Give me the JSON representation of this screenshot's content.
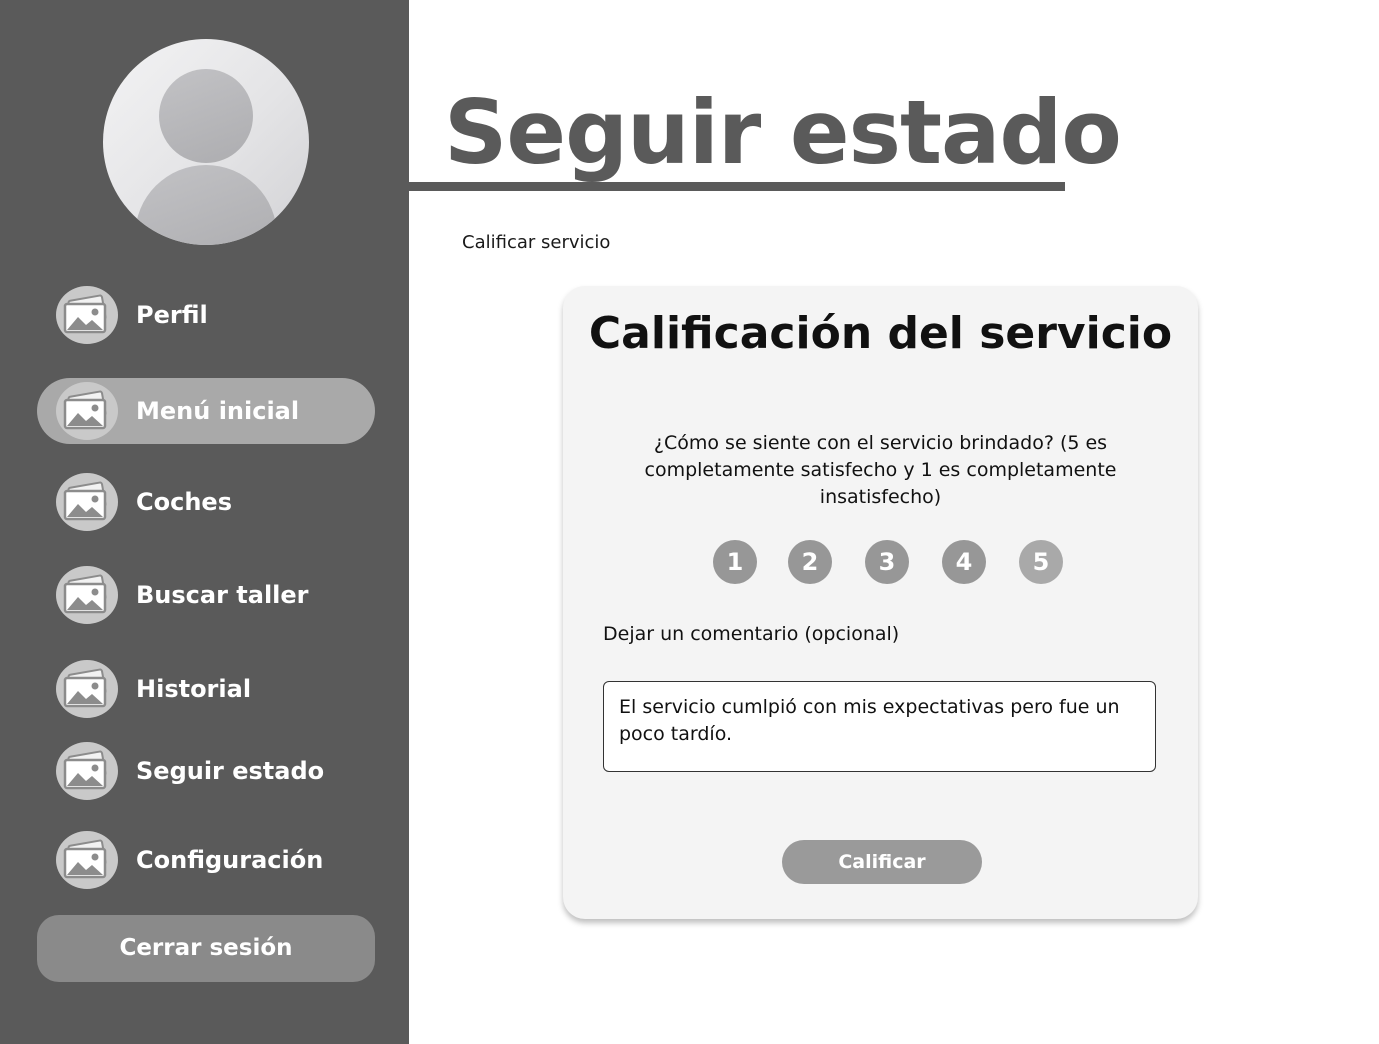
{
  "sidebar": {
    "items": [
      {
        "label": "Perfil",
        "icon": "image-icon",
        "active": false
      },
      {
        "label": "Menú inicial",
        "icon": "image-icon",
        "active": true
      },
      {
        "label": "Coches",
        "icon": "image-icon",
        "active": false
      },
      {
        "label": "Buscar taller",
        "icon": "image-icon",
        "active": false
      },
      {
        "label": "Historial",
        "icon": "image-icon",
        "active": false
      },
      {
        "label": "Seguir estado",
        "icon": "image-icon",
        "active": false
      },
      {
        "label": "Configuración",
        "icon": "image-icon",
        "active": false
      }
    ],
    "logout_label": "Cerrar sesión"
  },
  "header": {
    "title": "Seguir estado"
  },
  "main": {
    "section_label": "Calificar servicio",
    "card": {
      "title": "Calificación del servicio",
      "question": "¿Cómo se siente con el servicio brindado? (5 es completamente satisfecho y 1 es completamente insatisfecho)",
      "ratings": [
        "1",
        "2",
        "3",
        "4",
        "5"
      ],
      "comment_label": "Dejar un comentario (opcional)",
      "comment_value": "El servicio cumlpió con mis expectativas pero fue un poco tardío.",
      "submit_label": "Calificar"
    }
  },
  "colors": {
    "sidebar_bg": "#5a5a5a",
    "active_item": "#a9a9a9",
    "logout_bg": "#8a8a8a",
    "card_bg": "#f4f4f4",
    "rating_bg": "#979797",
    "submit_bg": "#9a9a9a"
  }
}
